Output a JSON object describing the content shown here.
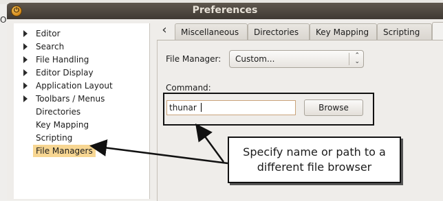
{
  "window": {
    "title": "Preferences"
  },
  "background": {
    "edge_text": "Op"
  },
  "icons": {
    "close": "close-icon"
  },
  "sidebar": {
    "items": [
      {
        "label": "Editor",
        "expandable": true
      },
      {
        "label": "Search",
        "expandable": true
      },
      {
        "label": "File Handling",
        "expandable": true
      },
      {
        "label": "Editor Display",
        "expandable": true
      },
      {
        "label": "Application Layout",
        "expandable": true
      },
      {
        "label": "Toolbars / Menus",
        "expandable": true
      },
      {
        "label": "Directories",
        "expandable": false
      },
      {
        "label": "Key Mapping",
        "expandable": false
      },
      {
        "label": "Scripting",
        "expandable": false
      },
      {
        "label": "File Managers",
        "expandable": false,
        "selected": true
      }
    ]
  },
  "tabs": {
    "scroll_left": "‹",
    "items": [
      "Miscellaneous",
      "Directories",
      "Key Mapping",
      "Scripting",
      ""
    ]
  },
  "panel": {
    "file_manager_label": "File Manager:",
    "file_manager_value": "Custom...",
    "command_label": "Command:",
    "command_value": "thunar",
    "browse_label": "Browse"
  },
  "annotation": {
    "line1": "Specify name or path to a",
    "line2": "different file browser"
  },
  "colors": {
    "selection": "#f7d692",
    "titlebar": "#4b443d"
  }
}
